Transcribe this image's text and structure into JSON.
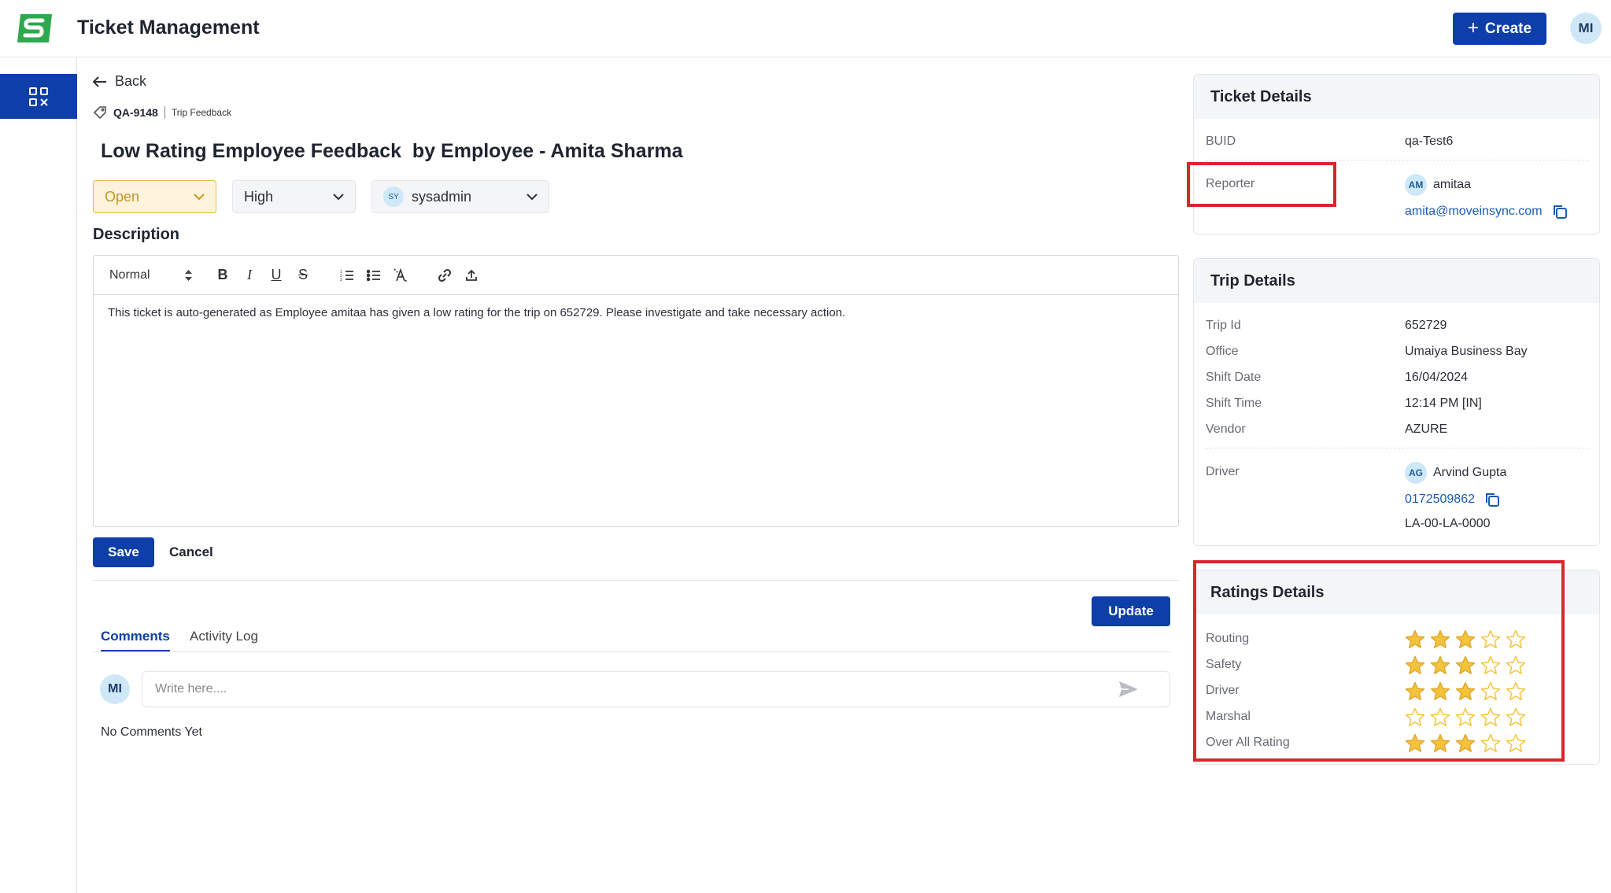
{
  "header": {
    "title": "Ticket Management",
    "create_label": "Create",
    "user_initials": "MI"
  },
  "colors": {
    "primary": "#0e3ea8",
    "logo_green": "#2fa84f",
    "star_gold": "#f5c33b",
    "highlight_red": "#d9262c"
  },
  "main": {
    "back_label": "Back",
    "ticket_id": "QA-9148",
    "ticket_type": "Trip Feedback",
    "title": "Low Rating Employee Feedback  by Employee - Amita Sharma",
    "status": "Open",
    "priority": "High",
    "assignee_initials": "SY",
    "assignee": "sysadmin",
    "description_label": "Description",
    "editor_format": "Normal",
    "description": "This ticket is auto-generated as Employee amitaa has given a low rating for the trip on 652729. Please investigate and take necessary action.",
    "save_label": "Save",
    "cancel_label": "Cancel",
    "update_label": "Update",
    "tabs": [
      "Comments",
      "Activity Log"
    ],
    "comment_avatar": "MI",
    "comment_placeholder": "Write here....",
    "no_comments": "No Comments Yet"
  },
  "ticket_details": {
    "title": "Ticket Details",
    "buid_label": "BUID",
    "buid": "qa-Test6",
    "reporter_label": "Reporter",
    "reporter_initials": "AM",
    "reporter_name": "amitaa",
    "reporter_email": "amita@moveinsync.com"
  },
  "trip_details": {
    "title": "Trip Details",
    "rows": [
      {
        "label": "Trip Id",
        "value": "652729"
      },
      {
        "label": "Office",
        "value": "Umaiya Business Bay"
      },
      {
        "label": "Shift Date",
        "value": "16/04/2024"
      },
      {
        "label": "Shift Time",
        "value": "12:14 PM [IN]"
      },
      {
        "label": "Vendor",
        "value": "AZURE"
      }
    ],
    "driver_label": "Driver",
    "driver_initials": "AG",
    "driver_name": "Arvind Gupta",
    "driver_phone": "0172509862",
    "vehicle": "LA-00-LA-0000"
  },
  "ratings_details": {
    "title": "Ratings Details",
    "max": 5,
    "rows": [
      {
        "label": "Routing",
        "value": 3
      },
      {
        "label": "Safety",
        "value": 3
      },
      {
        "label": "Driver",
        "value": 3
      },
      {
        "label": "Marshal",
        "value": 0
      },
      {
        "label": "Over All Rating",
        "value": 3
      }
    ]
  }
}
